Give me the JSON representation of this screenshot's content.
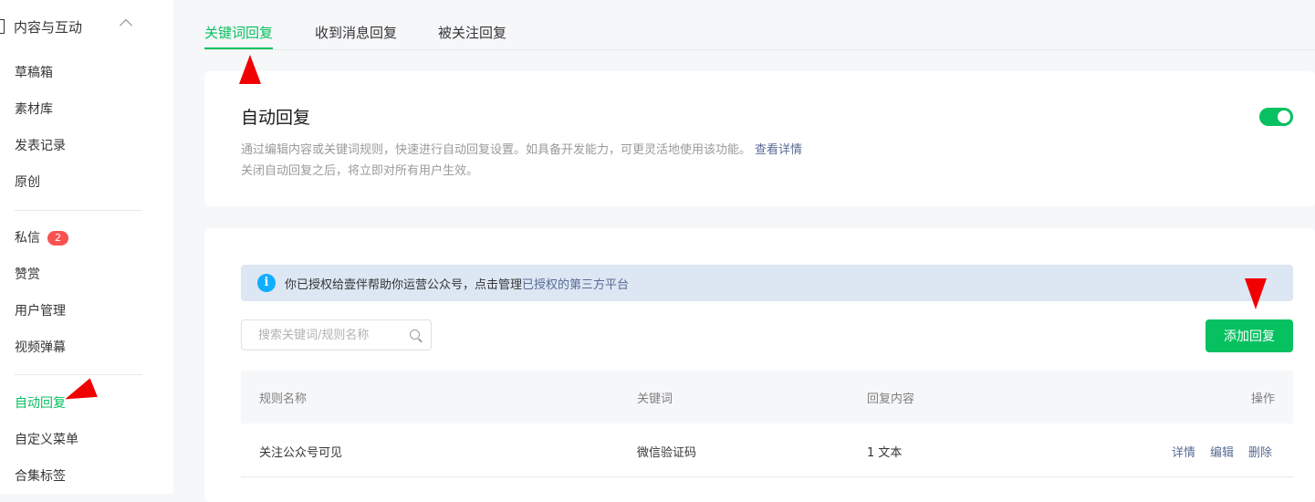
{
  "sidebar": {
    "section_label": "内容与互动",
    "items": [
      {
        "label": "草稿箱"
      },
      {
        "label": "素材库"
      },
      {
        "label": "发表记录"
      },
      {
        "label": "原创"
      },
      {
        "label": "私信",
        "badge": "2"
      },
      {
        "label": "赞赏"
      },
      {
        "label": "用户管理"
      },
      {
        "label": "视频弹幕"
      },
      {
        "label": "自动回复"
      },
      {
        "label": "自定义菜单"
      },
      {
        "label": "合集标签"
      }
    ]
  },
  "tabs": [
    {
      "label": "关键词回复"
    },
    {
      "label": "收到消息回复"
    },
    {
      "label": "被关注回复"
    }
  ],
  "auto_reply": {
    "title": "自动回复",
    "desc1": "通过编辑内容或关键词规则，快速进行自动回复设置。如具备开发能力，可更灵活地使用该功能。",
    "desc1_link": "查看详情",
    "desc2": "关闭自动回复之后，将立即对所有用户生效。"
  },
  "notice": {
    "text": "你已授权给壹伴帮助你运营公众号，点击管理",
    "link": "已授权的第三方平台"
  },
  "search": {
    "placeholder": "搜索关键词/规则名称"
  },
  "add_button": "添加回复",
  "table": {
    "headers": [
      "规则名称",
      "关键词",
      "回复内容",
      "操作"
    ],
    "rows": [
      {
        "name": "关注公众号可见",
        "keyword": "微信验证码",
        "content": "1 文本"
      }
    ],
    "actions": [
      "详情",
      "编辑",
      "删除"
    ]
  },
  "colors": {
    "accent": "#07c160",
    "link": "#576b95",
    "badge": "#fa5151",
    "annotation": "#f00000"
  }
}
